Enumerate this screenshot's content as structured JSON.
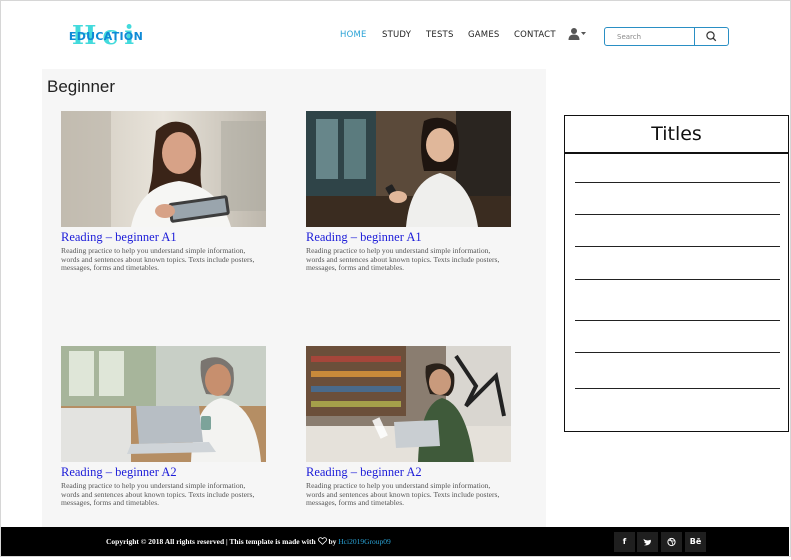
{
  "header": {
    "logo_top": "Hci",
    "logo_bottom": "EDUCATION",
    "nav": [
      "HOME",
      "STUDY",
      "TESTS",
      "GAMES",
      "CONTACT"
    ],
    "active_nav": "HOME",
    "search_placeholder": "Search"
  },
  "main": {
    "title": "Beginner",
    "cards": [
      {
        "title": "Reading – beginner A1",
        "desc": "Reading practice to help you understand simple information, words and sentences about known topics. Texts include posters, messages, forms and timetables.",
        "image": "woman-with-tablet"
      },
      {
        "title": "Reading – beginner A1",
        "desc": "Reading practice to help you understand simple information, words and sentences about known topics. Texts include posters, messages, forms and timetables.",
        "image": "woman-with-phone-in-cafe"
      },
      {
        "title": "Reading – beginner A2",
        "desc": "Reading practice to help you understand simple information, words and sentences about known topics. Texts include posters, messages, forms and timetables.",
        "image": "man-with-laptop-at-table"
      },
      {
        "title": "Reading – beginner A2",
        "desc": "Reading practice to help you understand simple information, words and sentences about known topics. Texts include posters, messages, forms and timetables.",
        "image": "woman-with-laptop-in-studio"
      }
    ]
  },
  "sidebar": {
    "title": "Titles",
    "line_count": 7
  },
  "footer": {
    "copyright": "Copyright © 2018 All rights reserved | This template is made with",
    "by": "by",
    "link": "Hci2019Group09",
    "social": [
      "f",
      "t",
      "dribbble",
      "Bē"
    ]
  },
  "colors": {
    "accent": "#2aa3d6",
    "link_blue": "#1d1dd9",
    "logo_cyan": "#23d4d6",
    "footer_bg": "#000000"
  }
}
